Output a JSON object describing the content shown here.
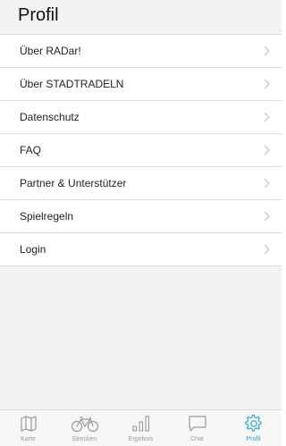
{
  "header": {
    "title": "Profil"
  },
  "menu": {
    "items": [
      {
        "label": "Über RADar!"
      },
      {
        "label": "Über STADTRADELN"
      },
      {
        "label": "Datenschutz"
      },
      {
        "label": "FAQ"
      },
      {
        "label": "Partner & Unterstützer"
      },
      {
        "label": "Spielregeln"
      },
      {
        "label": "Login"
      }
    ]
  },
  "tabbar": {
    "tabs": [
      {
        "label": "Karte",
        "icon": "map-icon"
      },
      {
        "label": "Strecken",
        "icon": "bicycle-icon"
      },
      {
        "label": "Ergebnis",
        "icon": "bar-chart-icon"
      },
      {
        "label": "Chat",
        "icon": "chat-bubble-icon"
      },
      {
        "label": "Profil",
        "icon": "gear-icon"
      }
    ],
    "active_index": 4
  },
  "colors": {
    "accent": "#2aa3c9",
    "inactive": "#9a9a9a",
    "background": "#f2f2f2",
    "separator": "#dcdcdc"
  }
}
